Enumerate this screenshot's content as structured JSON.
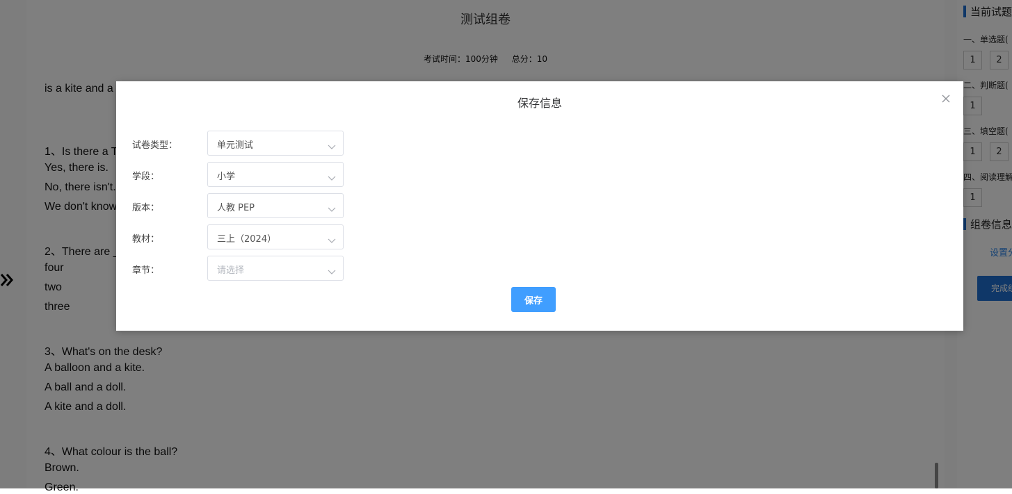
{
  "paper": {
    "title": "测试组卷",
    "exam_time": "考试时间：100分钟",
    "total_score": "总分：10",
    "lines": [
      "is a kite and a",
      "1、Is there a T",
      "Yes, there is.",
      "No, there isn't.",
      "We don't know",
      "2、There are _",
      "four",
      "two",
      "three",
      "3、What's on the desk?",
      "A balloon and a kite.",
      "A ball and a doll.",
      "A kite and a doll.",
      "4、What colour is the ball?",
      "Brown.",
      "Green."
    ]
  },
  "right_panel": {
    "current_heading": "当前试题",
    "sections": [
      {
        "label": "一、单选题(",
        "numbers": [
          "1",
          "2"
        ]
      },
      {
        "label": "二、判断题(",
        "numbers": [
          "1"
        ]
      },
      {
        "label": "三、填空题(",
        "numbers": [
          "1",
          "2"
        ]
      },
      {
        "label": "四、阅读理解",
        "numbers": [
          "1"
        ]
      }
    ],
    "info_heading": "组卷信息",
    "settings_link": "设置分",
    "finish_button": "完成组"
  },
  "modal": {
    "title": "保存信息",
    "fields": [
      {
        "label": "试卷类型：",
        "value": "单元测试",
        "placeholder": false
      },
      {
        "label": "学段：",
        "value": "小学",
        "placeholder": false
      },
      {
        "label": "版本：",
        "value": "人教 PEP",
        "placeholder": false
      },
      {
        "label": "教材：",
        "value": "三上（2024）",
        "placeholder": false
      },
      {
        "label": "章节：",
        "value": "请选择",
        "placeholder": true
      }
    ],
    "save_label": "保存"
  },
  "icons": {
    "close": "close-icon",
    "chevron": "chevron-down-icon",
    "expand": "double-chevron-right-icon"
  },
  "colors": {
    "primary": "#409eff",
    "accent_bar": "#1f6fd1",
    "link": "#2c84e8",
    "overlay": "rgba(0,0,0,0.5)"
  }
}
